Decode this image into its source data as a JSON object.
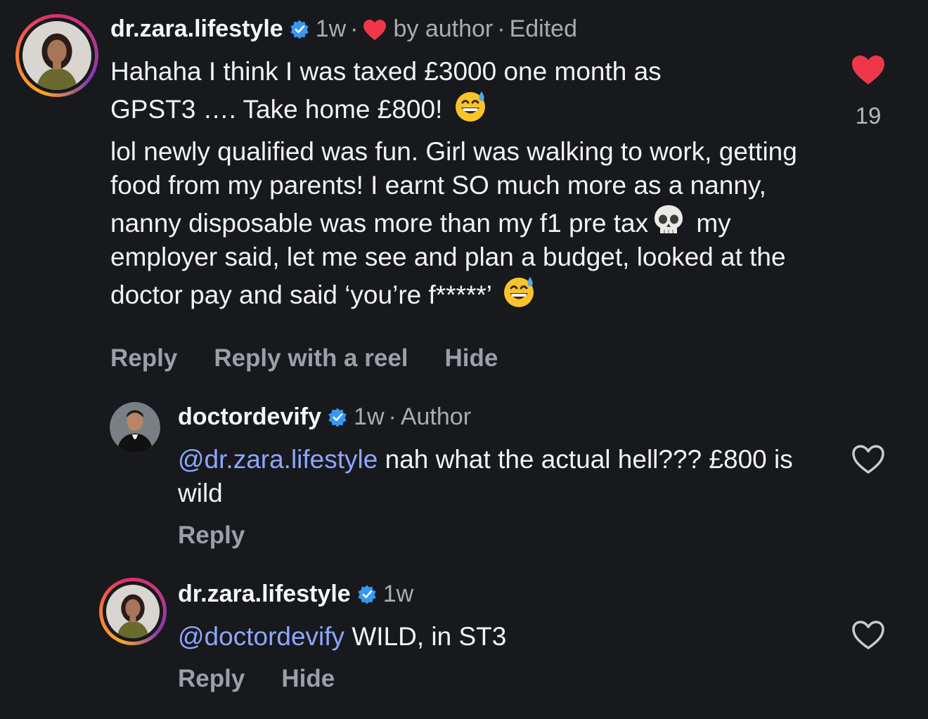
{
  "comments": [
    {
      "username": "dr.zara.lifestyle",
      "time": "1w",
      "liked_by_author_label": "by author",
      "edited_label": "Edited",
      "line1": "Hahaha I think I was taxed £3000 one month as",
      "line2": "GPST3 …. Take home £800!",
      "para2_a": "lol newly qualified was fun. Girl was walking to work, getting food from my parents! I earnt SO much more as a nanny, nanny disposable was more than my f1 pre tax",
      "para2_b": "my employer said, let me see and plan a budget, looked at the doctor pay and said ‘you’re f*****’",
      "actions": [
        "Reply",
        "Reply with a reel",
        "Hide"
      ],
      "like_count": "19",
      "liked": true
    },
    {
      "username": "doctordevify",
      "time": "1w",
      "role_label": "Author",
      "mention": "@dr.zara.lifestyle",
      "text": "nah what the actual hell??? £800 is wild",
      "actions": [
        "Reply"
      ],
      "liked": false
    },
    {
      "username": "dr.zara.lifestyle",
      "time": "1w",
      "mention": "@doctordevify",
      "text": "WILD, in ST3",
      "actions": [
        "Reply",
        "Hide"
      ],
      "liked": false
    }
  ],
  "icons": {
    "verified": "verified-badge-icon",
    "heart_filled": "heart-filled-icon",
    "heart_outline": "heart-outline-icon",
    "emoji_sweat_smile": "grinning-sweat-emoji",
    "emoji_skull": "skull-emoji"
  },
  "colors": {
    "background": "#17191c",
    "mention": "#8fa6ff",
    "like_red": "#f0374a",
    "verified_blue": "#3897f0",
    "muted": "#9aa0a8"
  }
}
